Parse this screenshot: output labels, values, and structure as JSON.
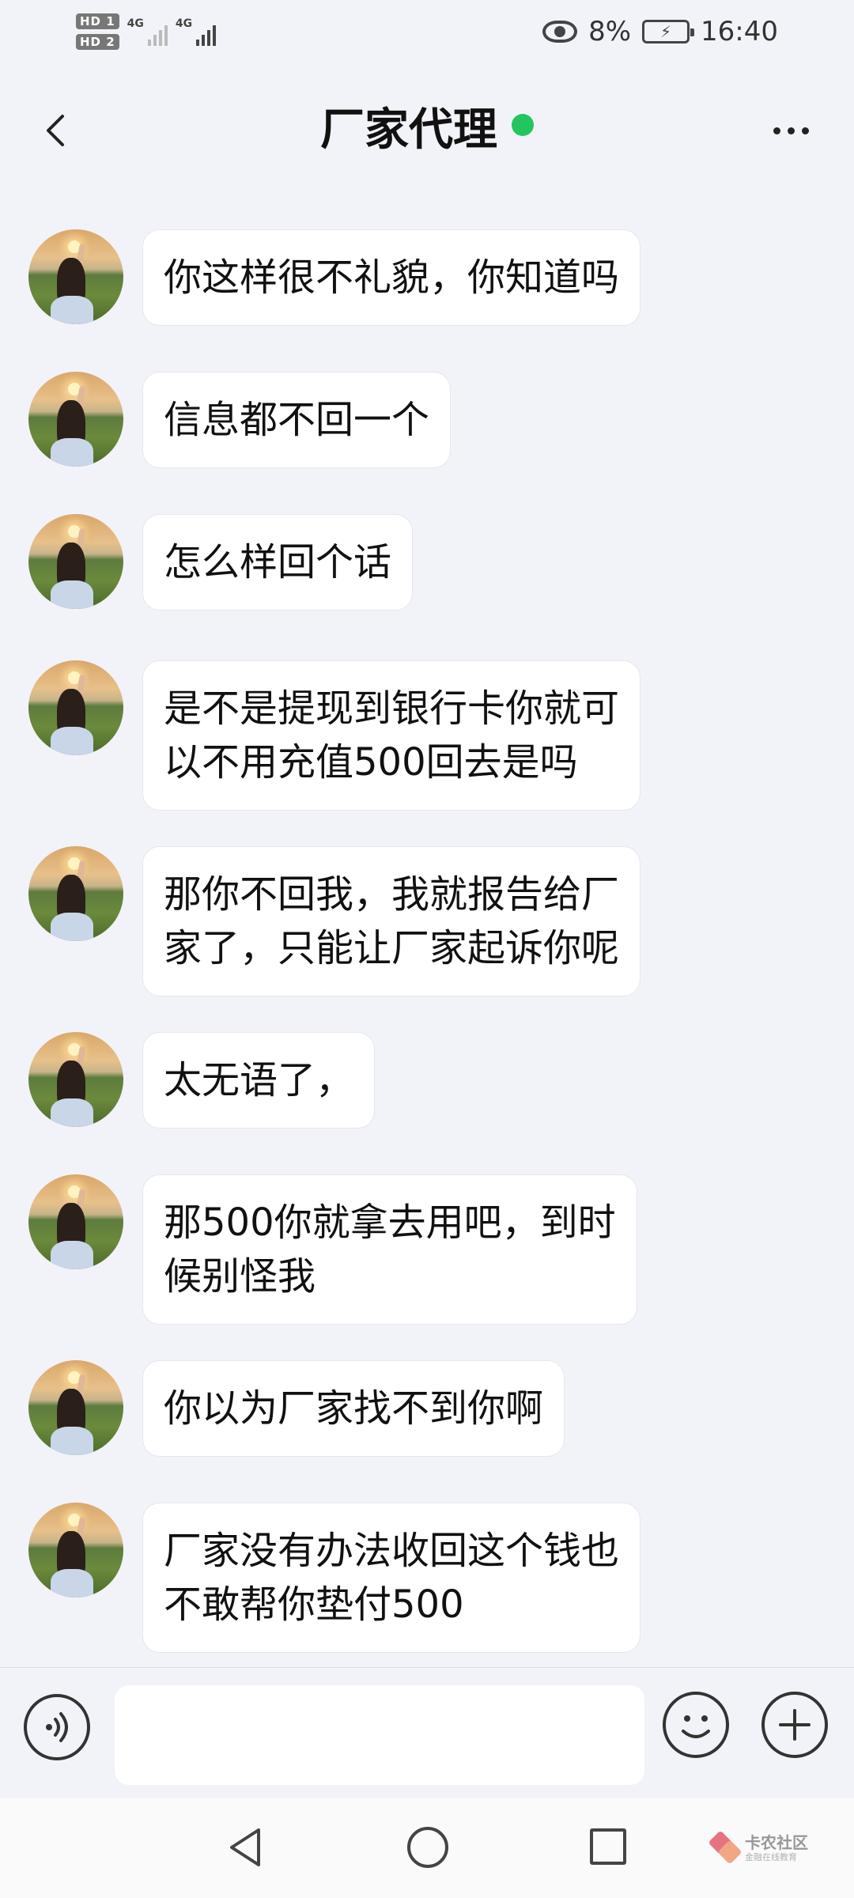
{
  "status_bar": {
    "sim1": "HD 1",
    "sim2": "HD 2",
    "network1": "4G",
    "network2": "4G",
    "battery_percent": "8%",
    "time": "16:40"
  },
  "header": {
    "title": "厂家代理",
    "online_color": "#22c55e"
  },
  "messages": [
    {
      "text": "你这样很不礼貌，你知道吗"
    },
    {
      "text": "信息都不回一个"
    },
    {
      "text": "怎么样回个话"
    },
    {
      "text": "是不是提现到银行卡你就可\n以不用充值500回去是吗"
    },
    {
      "text": "那你不回我，我就报告给厂\n家了，只能让厂家起诉你呢"
    },
    {
      "text": "太无语了，"
    },
    {
      "text": "那500你就拿去用吧，到时\n候别怪我"
    },
    {
      "text": "你以为厂家找不到你啊"
    },
    {
      "text": "厂家没有办法收回这个钱也\n不敢帮你垫付500"
    }
  ],
  "input": {
    "value": "",
    "placeholder": ""
  },
  "watermark": {
    "title": "卡农社区",
    "subtitle": "金融在线教育"
  },
  "icons": [
    "back-icon",
    "more-icon",
    "voice-icon",
    "emoji-icon",
    "plus-icon",
    "nav-back-icon",
    "nav-home-icon",
    "nav-recent-icon"
  ]
}
